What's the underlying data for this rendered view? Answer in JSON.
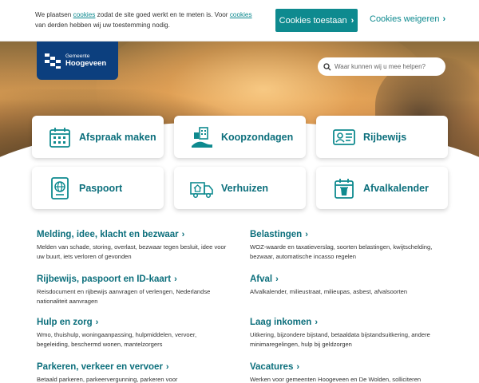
{
  "cookie": {
    "text_1": "We plaatsen ",
    "link_1": "cookies",
    "text_2": " zodat de site goed werkt en te meten is. Voor ",
    "link_2": "cookies",
    "text_3": " van derden hebben wij uw toestemming nodig.",
    "accept_label": "Cookies toestaan",
    "decline_label": "Cookies weigeren"
  },
  "logo": {
    "small": "Gemeente",
    "big": "Hoogeveen"
  },
  "search": {
    "placeholder": "Waar kunnen wij u mee helpen?"
  },
  "tiles": [
    {
      "label": "Afspraak maken",
      "icon": "calendar-icon"
    },
    {
      "label": "Koopzondagen",
      "icon": "shopping-street-icon"
    },
    {
      "label": "Rijbewijs",
      "icon": "id-card-icon"
    },
    {
      "label": "Paspoort",
      "icon": "passport-icon"
    },
    {
      "label": "Verhuizen",
      "icon": "moving-truck-icon"
    },
    {
      "label": "Afvalkalender",
      "icon": "waste-calendar-icon"
    }
  ],
  "topics": [
    {
      "title": "Melding, idee, klacht en bezwaar",
      "desc": "Melden van schade, storing, overlast, bezwaar tegen besluit, idee voor uw buurt, iets verloren of gevonden"
    },
    {
      "title": "Belastingen",
      "desc": "WOZ-waarde en taxatieverslag, soorten belastingen, kwijtschelding, bezwaar, automatische incasso regelen"
    },
    {
      "title": "Rijbewijs, paspoort en ID-kaart",
      "desc": "Reisdocument en rijbewijs aanvragen of verlengen, Nederlandse nationaliteit aanvragen"
    },
    {
      "title": "Afval",
      "desc": "Afvalkalender, milieustraat, milieupas, asbest, afvalsoorten"
    },
    {
      "title": "Hulp en zorg",
      "desc": "Wmo, thuishulp, woningaanpassing, hulpmiddelen, vervoer, begeleiding, beschermd wonen, mantelzorgers"
    },
    {
      "title": "Laag inkomen",
      "desc": "Uitkering, bijzondere bijstand, betaaldata bijstandsuitkering, andere minimaregelingen, hulp bij geldzorgen"
    },
    {
      "title": "Parkeren, verkeer en vervoer",
      "desc": "Betaald parkeren, parkeervergunning, parkeren voor"
    },
    {
      "title": "Vacatures",
      "desc": "Werken voor gemeenten Hoogeveen en De Wolden, solliciteren"
    }
  ],
  "colors": {
    "teal": "#0e8a8f",
    "title_teal": "#0c6f7c",
    "logo_blue": "#0c3f7e"
  }
}
